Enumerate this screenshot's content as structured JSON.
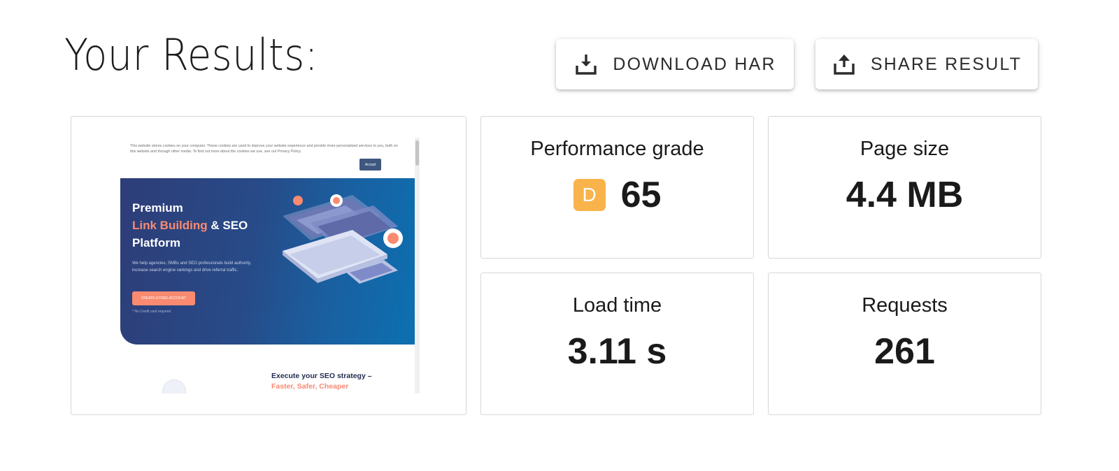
{
  "page": {
    "title": "Your Results:"
  },
  "actions": {
    "download_label": "DOWNLOAD HAR",
    "share_label": "SHARE RESULT"
  },
  "metrics": {
    "performance": {
      "label": "Performance grade",
      "grade": "D",
      "value": "65",
      "grade_color": "#f8b34a"
    },
    "page_size": {
      "label": "Page size",
      "value": "4.4 MB"
    },
    "load_time": {
      "label": "Load time",
      "value": "3.11 s"
    },
    "requests": {
      "label": "Requests",
      "value": "261"
    }
  },
  "preview": {
    "cookie_text": "This website stores cookies on your computer. These cookies are used to improve your website experience and provide more personalized services to you, both on this website and through other media. To find out more about the cookies we use, see our Privacy Policy.",
    "cookie_accept": "Accept",
    "hero_line1": "Premium",
    "hero_accent": "Link Building",
    "hero_line2_rest": " & SEO",
    "hero_line3": "Platform",
    "hero_paragraph": "We help agencies, SMBs and SEO professionals build authority, increase search engine rankings and drive referral traffic.",
    "hero_cta": "CREATE A FREE ACCOUNT",
    "hero_note": "* No Credit card required",
    "sub_heading": "Execute your SEO strategy –",
    "sub_accent": "Faster, Safer, Cheaper",
    "colors": {
      "hero_start": "#2e3d78",
      "hero_end": "#0c70b0",
      "accent": "#fa8a70"
    }
  }
}
